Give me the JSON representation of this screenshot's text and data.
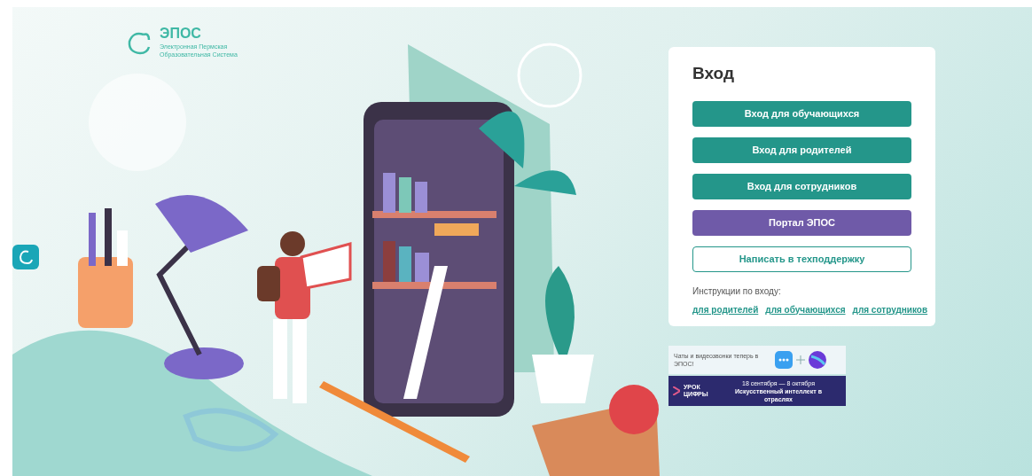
{
  "logo": {
    "title": "ЭПОС",
    "subtitle": [
      "Электронная Пермская",
      "Образовательная Система"
    ]
  },
  "login": {
    "title": "Вход",
    "buttons": [
      {
        "label": "Вход для обучающихся",
        "kind": "primary"
      },
      {
        "label": "Вход для родителей",
        "kind": "primary"
      },
      {
        "label": "Вход для сотрудников",
        "kind": "primary"
      },
      {
        "label": "Портал ЭПОС",
        "kind": "portal"
      },
      {
        "label": "Написать в техподдержку",
        "kind": "outline"
      }
    ],
    "instructions_label": "Инструкции по входу:",
    "instruction_links": [
      "для родителей",
      "для обучающихся",
      "для сотрудников"
    ]
  },
  "chat_banner": {
    "text": "Чаты и видеозвонки теперь в ЭПОС!"
  },
  "promo_banner": {
    "title": [
      "УРОК",
      "ЦИФРЫ"
    ],
    "dates": "18 сентября — 8 октября",
    "topic": "Искусственный интеллект в отраслях"
  }
}
